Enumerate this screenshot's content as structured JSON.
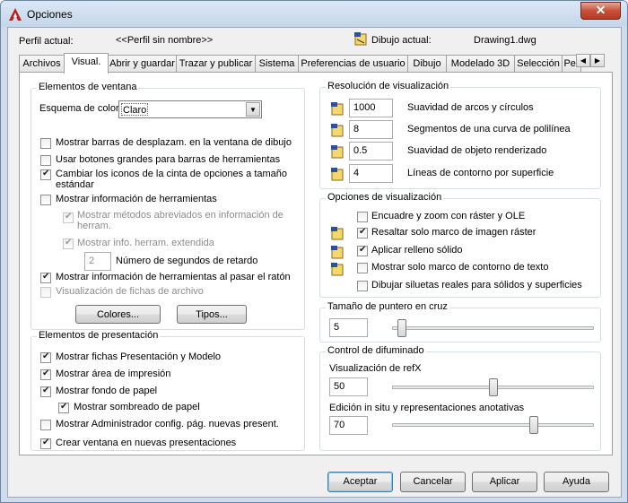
{
  "window": {
    "title": "Opciones",
    "close_glyph": "✕"
  },
  "header": {
    "profile_label": "Perfil actual:",
    "profile_value": "<<Perfil sin nombre>>",
    "drawing_label": "Dibujo actual:",
    "drawing_value": "Drawing1.dwg"
  },
  "tabs": [
    {
      "label": "Archivos"
    },
    {
      "label": "Visual."
    },
    {
      "label": "Abrir y guardar"
    },
    {
      "label": "Trazar y publicar"
    },
    {
      "label": "Sistema"
    },
    {
      "label": "Preferencias de usuario"
    },
    {
      "label": "Dibujo"
    },
    {
      "label": "Modelado 3D"
    },
    {
      "label": "Selección"
    },
    {
      "label": "Per"
    }
  ],
  "tab_scroll": {
    "left": "◀",
    "right": "▶"
  },
  "window_elements": {
    "title": "Elementos de ventana",
    "color_scheme_label": "Esquema de color:",
    "color_scheme_value": "Claro",
    "scrollbars": "Mostrar barras de desplazam. en la ventana de dibujo",
    "large_buttons": "Usar botones grandes para barras de herramientas",
    "resize_ribbon_1": "Cambiar los iconos de la cinta de opciones a tamaño",
    "resize_ribbon_2": "estándar",
    "tooltips": "Mostrar información de herramientas",
    "shortcut_keys_1": "Mostrar métodos abreviados en información de",
    "shortcut_keys_2": "herram.",
    "extended_tooltips": "Mostrar info. herram. extendida",
    "delay_value": "2",
    "delay_label": "Número de segundos de retardo",
    "rollover_tooltips": "Mostrar información de herramientas al pasar el ratón",
    "file_tabs": "Visualización de fichas de archivo",
    "colors_button": "Colores...",
    "fonts_button": "Tipos..."
  },
  "layout_elements": {
    "title": "Elementos de presentación",
    "layout_model_tabs": "Mostrar fichas Presentación y Modelo",
    "printable_area": "Mostrar área de impresión",
    "paper_background": "Mostrar fondo de papel",
    "paper_shadow": "Mostrar sombreado de papel",
    "page_setup_manager": "Mostrar Administrador config. pág. nuevas present.",
    "create_viewport": "Crear ventana en nuevas presentaciones"
  },
  "display_resolution": {
    "title": "Resolución de visualización",
    "arc_smoothness_value": "1000",
    "arc_smoothness_label": "Suavidad de arcos y círculos",
    "polyline_segments_value": "8",
    "polyline_segments_label": "Segmentos de una curva de polilínea",
    "rendered_smoothness_value": "0.5",
    "rendered_smoothness_label": "Suavidad de objeto renderizado",
    "contour_lines_value": "4",
    "contour_lines_label": "Líneas de contorno por superficie"
  },
  "display_performance": {
    "title": "Opciones de visualización",
    "pan_zoom_raster": "Encuadre y zoom con ráster y OLE",
    "highlight_raster_frame": "Resaltar solo marco de imagen ráster",
    "solid_fill": "Aplicar relleno sólido",
    "text_boundary": "Mostrar solo marco de contorno de texto",
    "silhouettes": "Dibujar siluetas reales para sólidos y superficies"
  },
  "crosshair": {
    "title": "Tamaño de puntero en cruz",
    "value": "5",
    "level_percent": 5
  },
  "fade_control": {
    "title": "Control de difuminado",
    "xref_label": "Visualización de refX",
    "xref_value": "50",
    "inplace_label": "Edición in situ y representaciones anotativas",
    "inplace_value": "70"
  },
  "footer": {
    "ok": "Aceptar",
    "cancel": "Cancelar",
    "apply": "Aplicar",
    "help": "Ayuda"
  },
  "colors": {
    "title_bar": "#c5d6ea",
    "close": "#c9503a",
    "default_button_border": "#3c7fb1"
  }
}
